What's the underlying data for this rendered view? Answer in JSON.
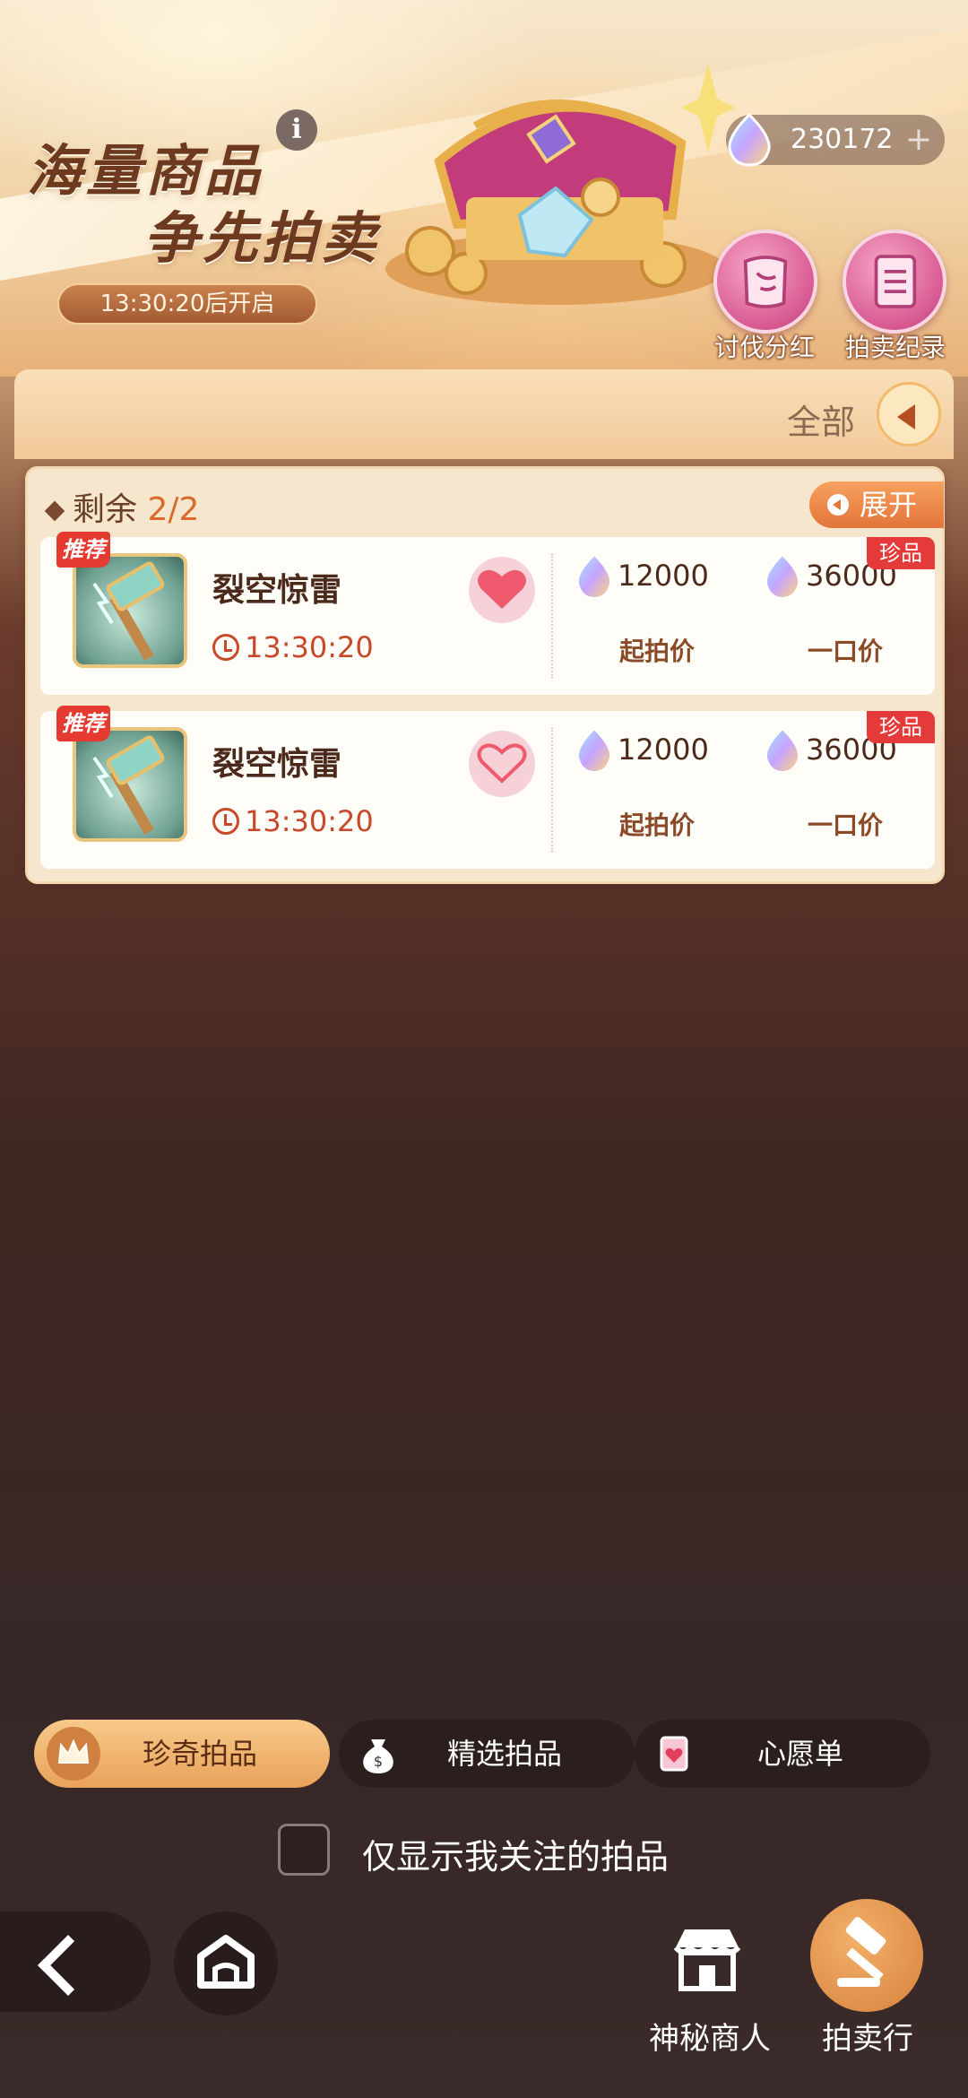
{
  "banner": {
    "title_line1": "海量商品",
    "title_line2": "争先拍卖",
    "info_glyph": "i",
    "countdown": "13:30:20后开启"
  },
  "currency": {
    "amount": "230172",
    "plus": "+"
  },
  "side_buttons": {
    "dividend_label": "讨伐分红",
    "records_label": "拍卖纪录"
  },
  "filter": {
    "label": "全部"
  },
  "panel": {
    "remaining_label": "剩余",
    "remaining_count": "2/2",
    "expand_label": "展开"
  },
  "items": [
    {
      "badge": "推荐",
      "name": "裂空惊雷",
      "time": "13:30:20",
      "favorited": true,
      "rare_tag": "珍品",
      "start_price": "12000",
      "start_label": "起拍价",
      "buyout_price": "36000",
      "buyout_label": "一口价"
    },
    {
      "badge": "推荐",
      "name": "裂空惊雷",
      "time": "13:30:20",
      "favorited": false,
      "rare_tag": "珍品",
      "start_price": "12000",
      "start_label": "起拍价",
      "buyout_price": "36000",
      "buyout_label": "一口价"
    }
  ],
  "tabs": [
    {
      "label": "珍奇拍品",
      "icon": "crown-icon",
      "active": true
    },
    {
      "label": "精选拍品",
      "icon": "money-bag-icon",
      "active": false
    },
    {
      "label": "心愿单",
      "icon": "wishlist-icon",
      "active": false
    }
  ],
  "only_watched": {
    "label": "仅显示我关注的拍品",
    "checked": false
  },
  "bottom_nav": {
    "merchant_label": "神秘商人",
    "auction_label": "拍卖行"
  },
  "colors": {
    "accent_orange": "#e3743a",
    "price_red": "#c8482a",
    "rare_red": "#e53a3a",
    "heart_pink": "#ef5a6f"
  }
}
